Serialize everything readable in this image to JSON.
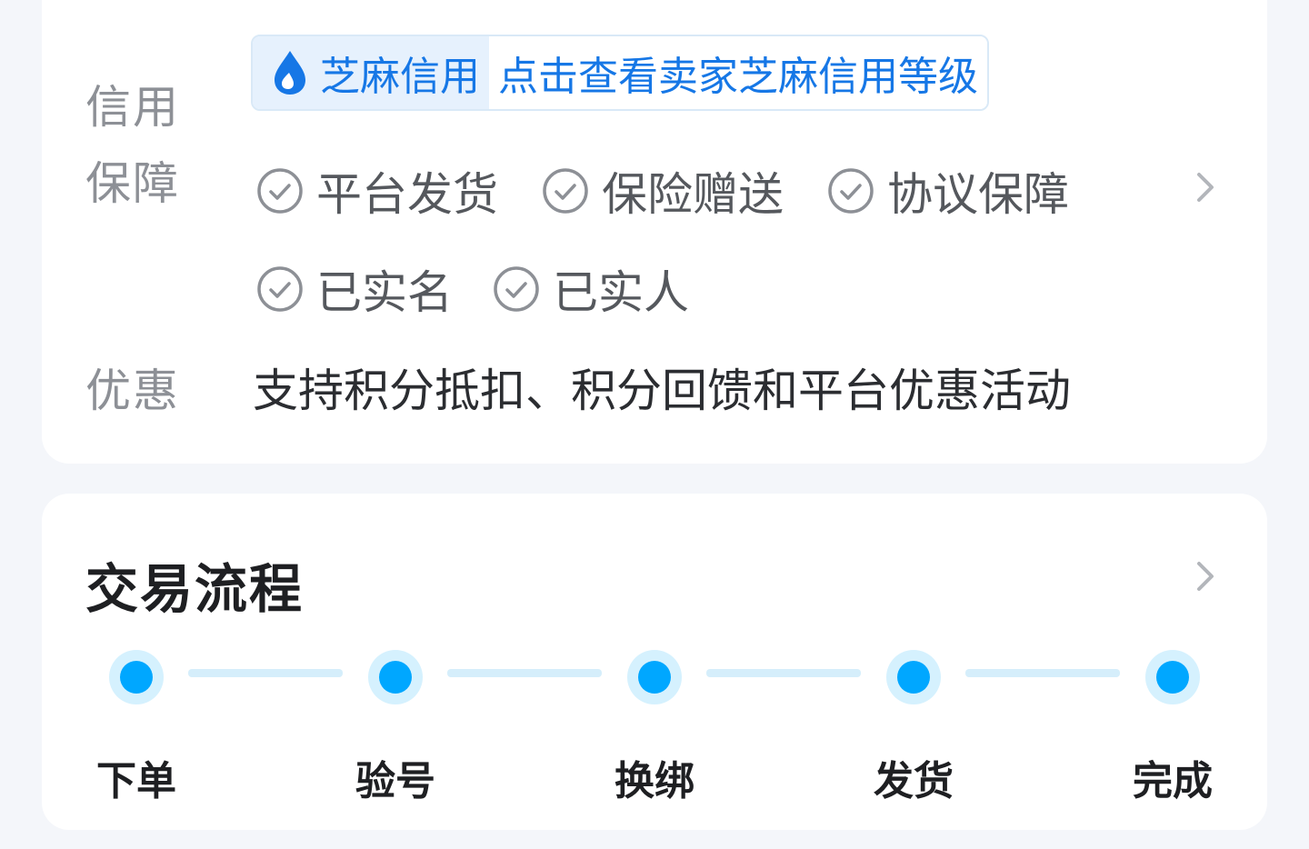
{
  "credit": {
    "label": "信用",
    "brand": "芝麻信用",
    "link_text": "点击查看卖家芝麻信用等级",
    "brand_color": "#1677e6",
    "icon": "sesame-drop-icon"
  },
  "guarantee": {
    "label": "保障",
    "items": [
      "平台发货",
      "保险赠送",
      "协议保障",
      "已实名",
      "已实人"
    ],
    "icon": "check-circle-icon"
  },
  "promo": {
    "label": "优惠",
    "text": "支持积分抵扣、积分回馈和平台优惠活动"
  },
  "flow": {
    "title": "交易流程",
    "steps": [
      "下单",
      "验号",
      "换绑",
      "发货",
      "完成"
    ],
    "accent_color": "#00a7ff"
  }
}
